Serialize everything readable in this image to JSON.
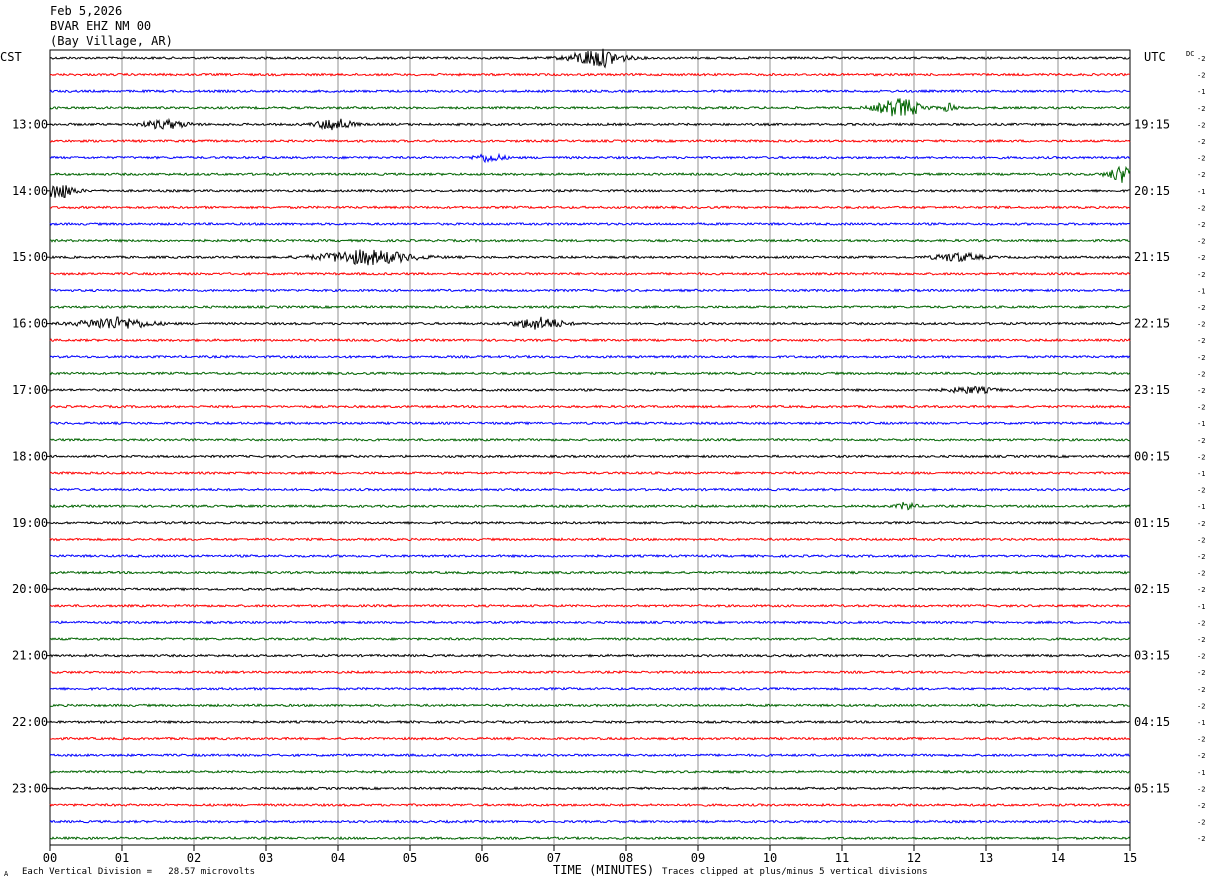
{
  "header": {
    "date": "Feb 5,2026",
    "station": "BVAR EHZ NM 00",
    "location": "(Bay Village, AR)"
  },
  "chart_data": {
    "type": "line",
    "title": "",
    "xlabel": "TIME (MINUTES)",
    "ylabel": "",
    "xlim": [
      0,
      15
    ],
    "x_ticks": [
      "00",
      "01",
      "02",
      "03",
      "04",
      "05",
      "06",
      "07",
      "08",
      "09",
      "10",
      "11",
      "12",
      "13",
      "14",
      "15"
    ],
    "left_timezone": "CST",
    "right_timezone": "UTC",
    "dc_label": "DC",
    "trace_colors": [
      "#000000",
      "#ff0000",
      "#0000ff",
      "#006400"
    ],
    "left_hour_labels": [
      {
        "row": 4,
        "text": "13:00"
      },
      {
        "row": 8,
        "text": "14:00"
      },
      {
        "row": 12,
        "text": "15:00"
      },
      {
        "row": 16,
        "text": "16:00"
      },
      {
        "row": 20,
        "text": "17:00"
      },
      {
        "row": 24,
        "text": "18:00"
      },
      {
        "row": 28,
        "text": "19:00"
      },
      {
        "row": 32,
        "text": "20:00"
      },
      {
        "row": 36,
        "text": "21:00"
      },
      {
        "row": 40,
        "text": "22:00"
      },
      {
        "row": 44,
        "text": "23:00"
      }
    ],
    "right_hour_labels": [
      {
        "row": 4,
        "text": "19:15"
      },
      {
        "row": 8,
        "text": "20:15"
      },
      {
        "row": 12,
        "text": "21:15"
      },
      {
        "row": 16,
        "text": "22:15"
      },
      {
        "row": 20,
        "text": "23:15"
      },
      {
        "row": 24,
        "text": "00:15"
      },
      {
        "row": 28,
        "text": "01:15"
      },
      {
        "row": 32,
        "text": "02:15"
      },
      {
        "row": 36,
        "text": "03:15"
      },
      {
        "row": 40,
        "text": "04:15"
      },
      {
        "row": 44,
        "text": "05:15"
      }
    ],
    "dc_offsets": [
      "-2",
      "-2",
      "-1",
      "-2",
      "-2",
      "-2",
      "-2",
      "-2",
      "-1",
      "-2",
      "-2",
      "-2",
      "-2",
      "-2",
      "-1",
      "-2",
      "-2",
      "-2",
      "-2",
      "-2",
      "-2",
      "-2",
      "-1",
      "-2",
      "-2",
      "-1",
      "-2",
      "-1",
      "-2",
      "-2",
      "-2",
      "-2",
      "-2",
      "-1",
      "-2",
      "-2",
      "-2",
      "-2",
      "-2",
      "-2",
      "-1",
      "-2",
      "-2",
      "-1",
      "-2",
      "-2",
      "-2",
      "-2"
    ],
    "events": [
      {
        "row": 0,
        "center_min": 7.6,
        "width_min": 0.9,
        "amplitude": 9
      },
      {
        "row": 3,
        "center_min": 11.8,
        "width_min": 0.8,
        "amplitude": 9
      },
      {
        "row": 3,
        "center_min": 12.5,
        "width_min": 0.2,
        "amplitude": 5
      },
      {
        "row": 4,
        "center_min": 1.6,
        "width_min": 0.8,
        "amplitude": 4
      },
      {
        "row": 4,
        "center_min": 3.95,
        "width_min": 0.6,
        "amplitude": 6
      },
      {
        "row": 6,
        "center_min": 6.1,
        "width_min": 0.5,
        "amplitude": 4
      },
      {
        "row": 7,
        "center_min": 14.9,
        "width_min": 0.5,
        "amplitude": 8
      },
      {
        "row": 8,
        "center_min": 0.1,
        "width_min": 0.6,
        "amplitude": 8
      },
      {
        "row": 12,
        "center_min": 4.4,
        "width_min": 1.6,
        "amplitude": 7
      },
      {
        "row": 12,
        "center_min": 12.6,
        "width_min": 0.8,
        "amplitude": 4
      },
      {
        "row": 16,
        "center_min": 0.9,
        "width_min": 1.2,
        "amplitude": 6
      },
      {
        "row": 16,
        "center_min": 6.8,
        "width_min": 0.8,
        "amplitude": 6
      },
      {
        "row": 20,
        "center_min": 12.8,
        "width_min": 0.8,
        "amplitude": 3
      },
      {
        "row": 27,
        "center_min": 11.9,
        "width_min": 0.3,
        "amplitude": 4
      }
    ]
  },
  "footer": {
    "scale_text": "Each Vertical Division =   28.57 microvolts",
    "clip_text": "Traces clipped at plus/minus 5 vertical divisions",
    "corner_mark": "A"
  }
}
